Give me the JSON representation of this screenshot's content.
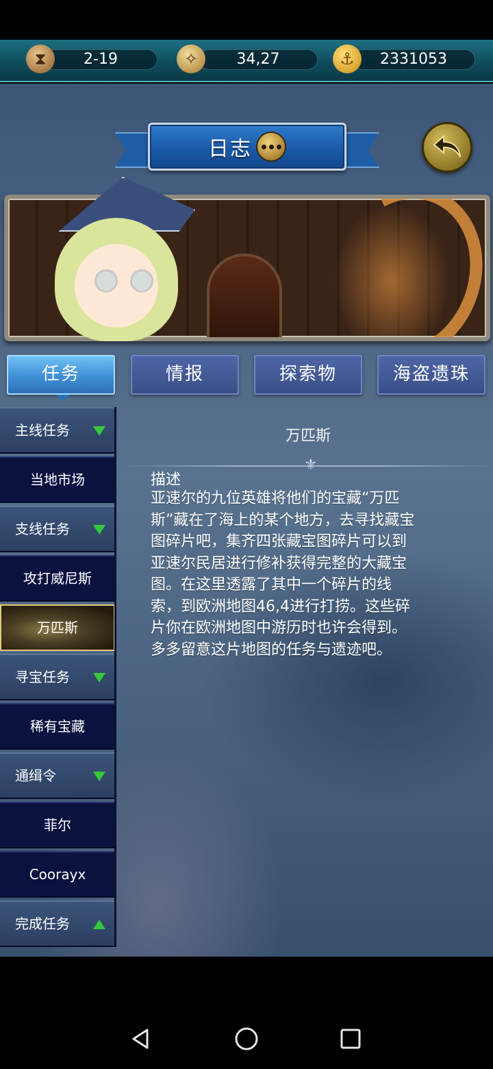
{
  "status_bar": {
    "time_value": "2-19",
    "coordinates_value": "34,27",
    "gold_value": "2331053",
    "icons": [
      "hourglass-icon",
      "compass-icon",
      "anchor-coin-icon"
    ]
  },
  "header": {
    "title": "日志",
    "title_icon": "chat-bubble-icon",
    "back_icon": "back-arrow-icon"
  },
  "tabs": [
    {
      "label": "任务",
      "active": true
    },
    {
      "label": "情报",
      "active": false
    },
    {
      "label": "探索物",
      "active": false
    },
    {
      "label": "海盗遗珠",
      "active": false
    }
  ],
  "sidebar": {
    "items": [
      {
        "label": "主线任务",
        "type": "header",
        "expanded": true
      },
      {
        "label": "当地市场",
        "type": "item"
      },
      {
        "label": "支线任务",
        "type": "header",
        "expanded": true
      },
      {
        "label": "攻打威尼斯",
        "type": "item"
      },
      {
        "label": "万匹斯",
        "type": "item",
        "selected": true
      },
      {
        "label": "寻宝任务",
        "type": "header",
        "expanded": true
      },
      {
        "label": "稀有宝藏",
        "type": "item"
      },
      {
        "label": "通缉令",
        "type": "header",
        "expanded": true
      },
      {
        "label": "菲尔",
        "type": "item"
      },
      {
        "label": "Coorayx",
        "type": "item"
      },
      {
        "label": "完成任务",
        "type": "header",
        "expanded": false
      }
    ]
  },
  "detail": {
    "title": "万匹斯",
    "heading": "描述",
    "lines": [
      "亚速尔的九位英雄将他们的宝藏“万匹",
      "斯”藏在了海上的某个地方，去寻找藏宝",
      "图碎片吧，集齐四张藏宝图碎片可以到",
      "亚速尔民居进行修补获得完整的大藏宝",
      "图。在这里透露了其中一个碎片的线",
      "索，到欧洲地图46,4进行打捞。这些碎",
      "片你在欧洲地图中游历时也许会得到。",
      "多多留意这片地图的任务与遗迹吧。"
    ]
  },
  "colors": {
    "accent_green": "#34c83a",
    "tab_active": "#3f8fd6",
    "tab_inactive": "#3a4f88",
    "list_bg": "#0b1240",
    "selected_border": "#e8c979"
  },
  "nav": {
    "icons": [
      "back-triangle-icon",
      "home-circle-icon",
      "recents-square-icon"
    ]
  }
}
